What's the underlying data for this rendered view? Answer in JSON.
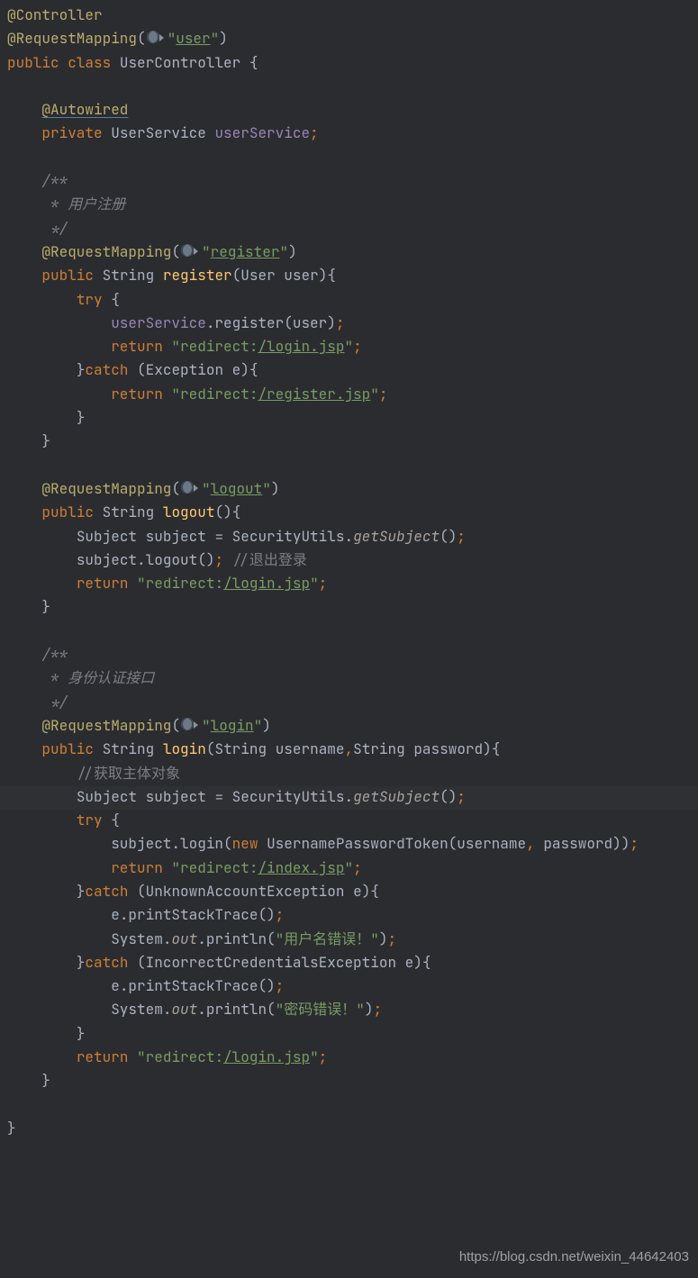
{
  "watermark": "https://blog.csdn.net/weixin_44642403",
  "tokens": {
    "ann_controller": "@Controller",
    "ann_reqmap": "@RequestMapping",
    "ann_autowired": "@Autowired",
    "kw_public": "public",
    "kw_private": "private",
    "kw_class": "class",
    "kw_try": "try",
    "kw_catch": "catch",
    "kw_return": "return",
    "kw_new": "new",
    "cls_UserController": "UserController",
    "cls_UserService": "UserService",
    "cls_String": "String",
    "cls_User": "User",
    "cls_Subject": "Subject",
    "cls_SecurityUtils": "SecurityUtils",
    "cls_System": "System",
    "cls_Exception": "Exception",
    "cls_UnknownAccountException": "UnknownAccountException",
    "cls_IncorrectCredentialsException": "IncorrectCredentialsException",
    "cls_UsernamePasswordToken": "UsernamePasswordToken",
    "fld_userService": "userService",
    "fld_out": "out",
    "m_register": "register",
    "m_logout": "logout",
    "m_login": "login",
    "m_getSubject": "getSubject",
    "m_printStackTrace": "printStackTrace",
    "m_println": "println",
    "p_user": "user",
    "p_username": "username",
    "p_password": "password",
    "v_subject": "subject",
    "v_e": "e",
    "str_user": "user",
    "str_register": "register",
    "str_logout": "logout",
    "str_login": "login",
    "str_redirect": "redirect:",
    "str_login_jsp": "/login.jsp",
    "str_register_jsp": "/register.jsp",
    "str_index_jsp": "/index.jsp",
    "str_err_user": "用户名错误！",
    "str_err_pwd": "密码错误！",
    "q": "\"",
    "com_open": "/**",
    "com_close": " */",
    "com_reg": " * 用户注册",
    "com_auth": " * 身份认证接口",
    "com_logout": "//退出登录",
    "com_getsubj": "//获取主体对象"
  }
}
